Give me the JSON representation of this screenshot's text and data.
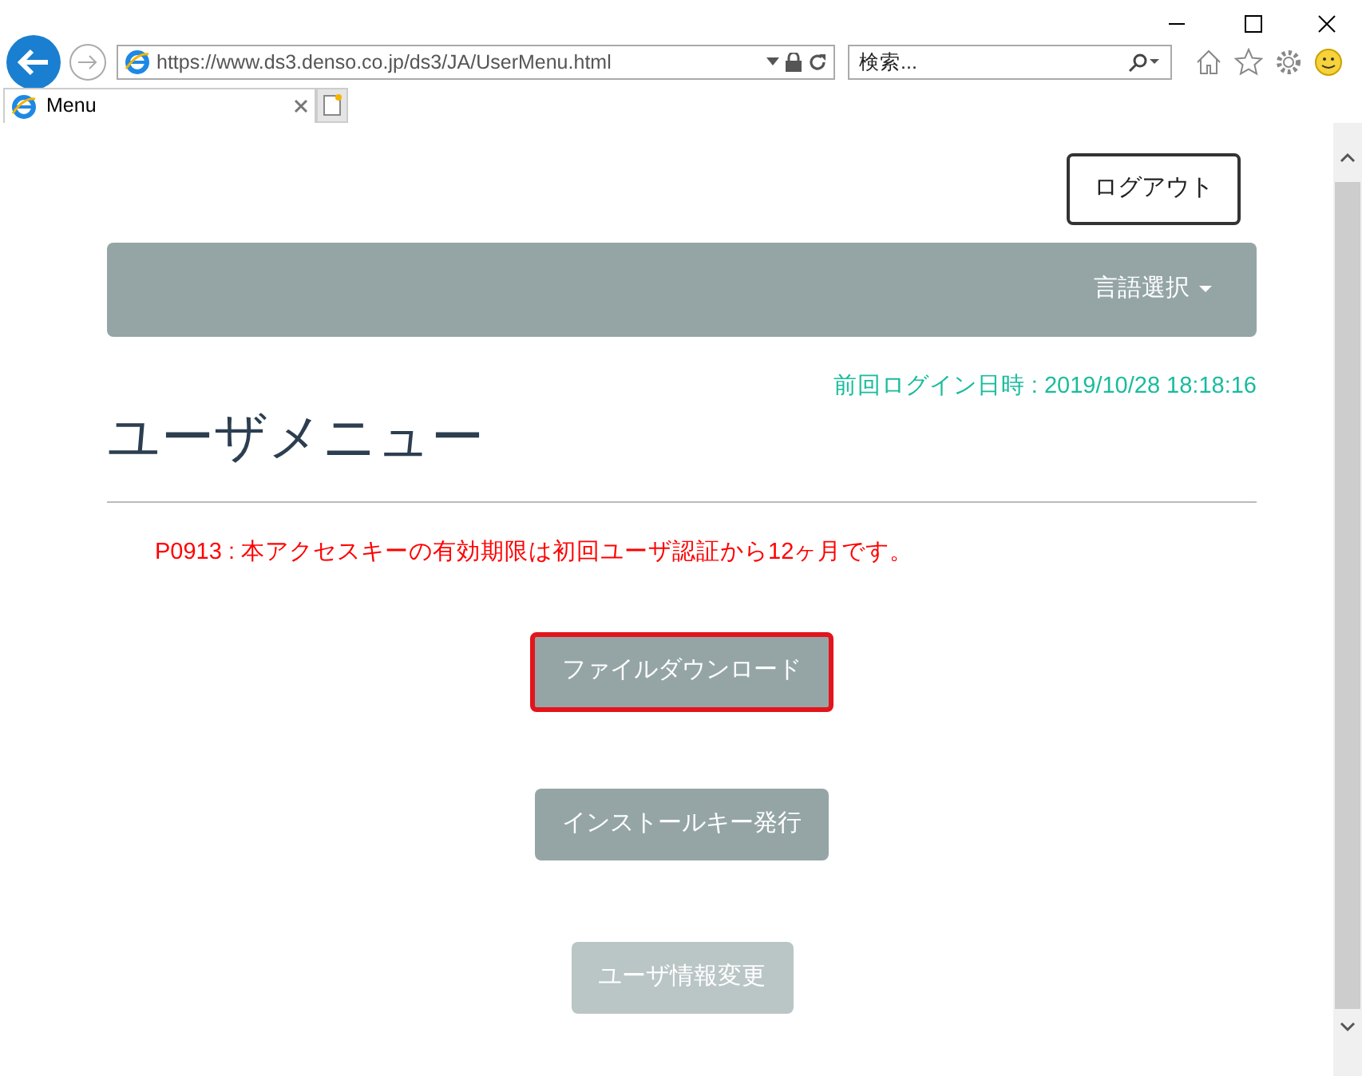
{
  "browser": {
    "url": "https://www.ds3.denso.co.jp/ds3/JA/UserMenu.html",
    "search": {
      "placeholder": "検索..."
    },
    "tabs": [
      {
        "label": "Menu",
        "selected": true
      }
    ]
  },
  "logout_button": "ログアウト",
  "navbar": {
    "language_menu": "言語選択"
  },
  "last_login": "前回ログイン日時 : 2019/10/28 18:18:16",
  "title": "ユーザメニュー",
  "notice": "P0913 : 本アクセスキーの有効期限は初回ユーザ認証から12ヶ月です。",
  "menu_buttons": [
    {
      "label": "ファイルダウンロード",
      "disabled": false,
      "highlighted": true
    },
    {
      "label": "インストールキー発行",
      "disabled": false,
      "highlighted": false
    },
    {
      "label": "ユーザ情報変更",
      "disabled": true,
      "highlighted": false
    }
  ]
}
